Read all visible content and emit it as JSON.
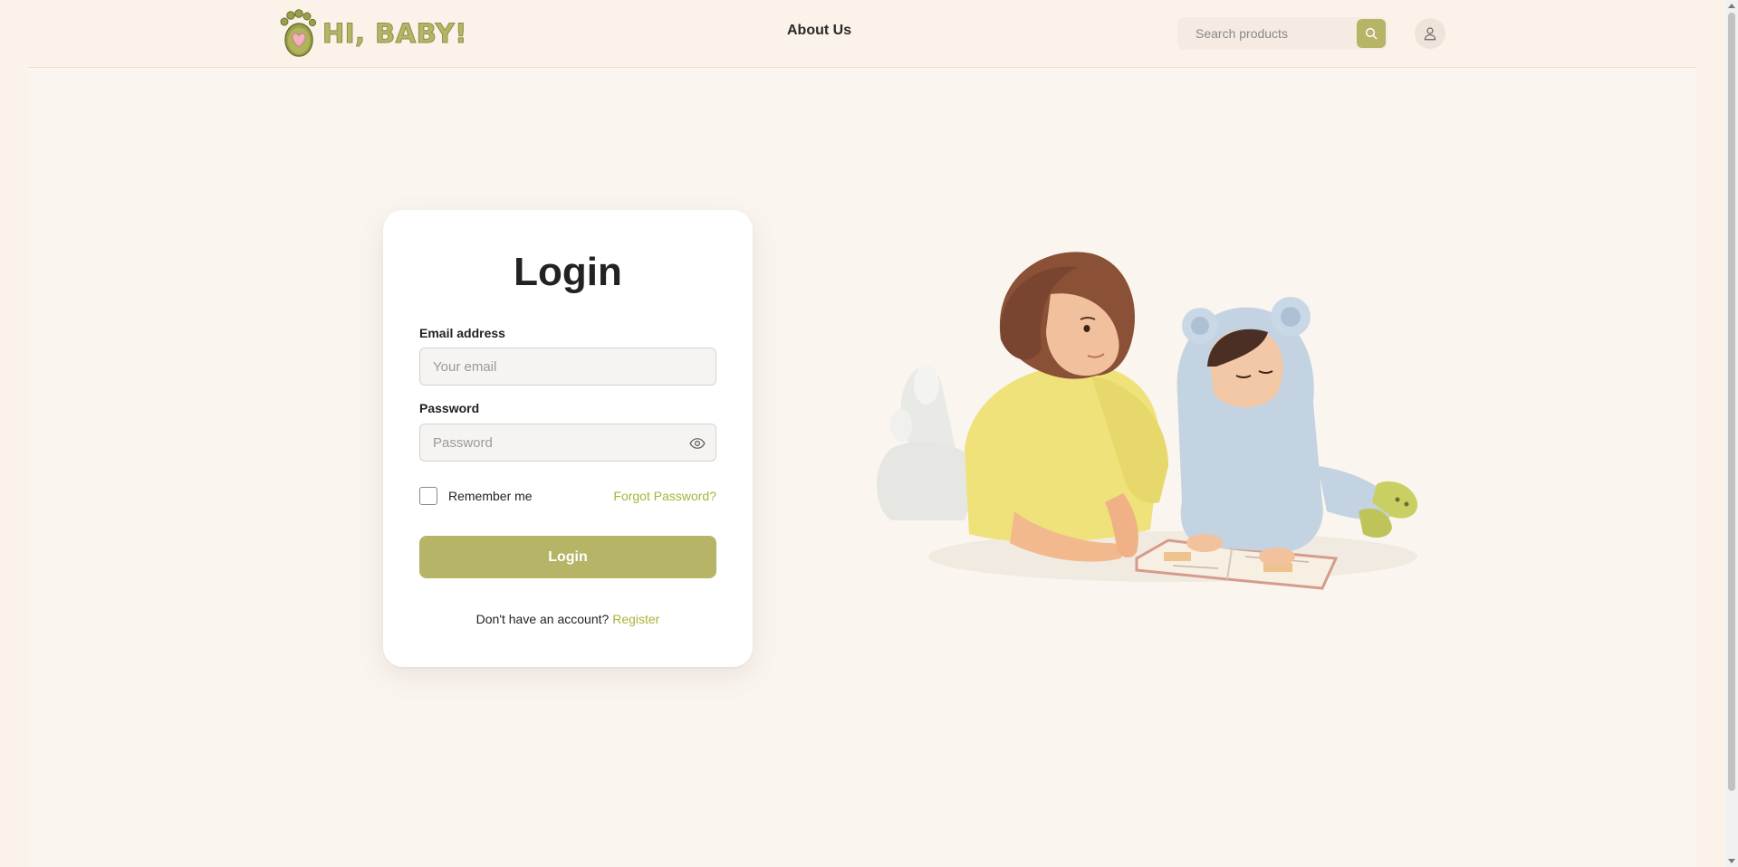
{
  "brand": {
    "name": "HI, BABY!",
    "accent_color": "#b5b467",
    "link_color": "#a9b33a",
    "background_color": "#fbf2ea"
  },
  "header": {
    "nav_about": "About Us",
    "search": {
      "placeholder": "Search products",
      "button_icon": "search-icon"
    },
    "account_icon": "user-icon"
  },
  "login": {
    "title": "Login",
    "email_label": "Email address",
    "email_placeholder": "Your email",
    "email_value": "",
    "password_label": "Password",
    "password_placeholder": "Password",
    "password_value": "",
    "password_toggle_icon": "eye-icon",
    "remember_label": "Remember me",
    "remember_checked": false,
    "forgot_label": "Forgot Password?",
    "submit_label": "Login",
    "no_account_text": "Don't have an account?",
    "register_label": "Register"
  },
  "illustration": {
    "description_icon": "mother-and-child-reading-illustration"
  }
}
